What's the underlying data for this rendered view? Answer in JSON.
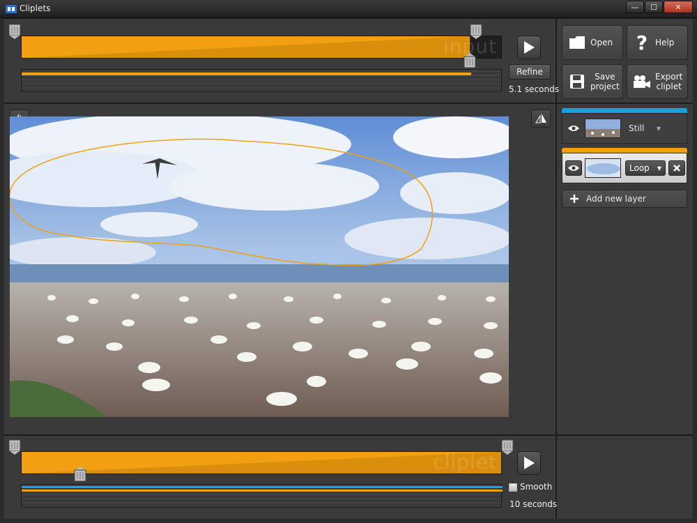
{
  "window": {
    "title": "Cliplets",
    "minimize": "—",
    "maximize": "☐",
    "close": "✕"
  },
  "input_timeline": {
    "label": "input",
    "refine_label": "Refine",
    "duration": "5.1 seconds",
    "selection_end": 0.94
  },
  "toolbar": {
    "open": "Open",
    "help": "Help",
    "save_line1": "Save",
    "save_line2": "project",
    "export_line1": "Export",
    "export_line2": "cliplet"
  },
  "layers": {
    "items": [
      {
        "mode": "Still",
        "strip_color": "#1aa0e0"
      },
      {
        "mode": "Loop",
        "strip_color": "#f0a010"
      }
    ],
    "add_label": "Add new layer"
  },
  "output_timeline": {
    "label": "cliplet",
    "smooth_label": "Smooth",
    "smooth_checked": false,
    "duration": "10 seconds",
    "playhead": 0.12
  },
  "colors": {
    "accent": "#f0a010",
    "blue": "#1aa0e0",
    "panel": "#3a3a3b"
  },
  "icons": [
    "app-icon",
    "play-icon",
    "folder-icon",
    "question-icon",
    "floppy-icon",
    "camera-icon",
    "eye-icon",
    "plus-icon",
    "x-icon",
    "mirror-left-icon",
    "mirror-right-icon"
  ]
}
